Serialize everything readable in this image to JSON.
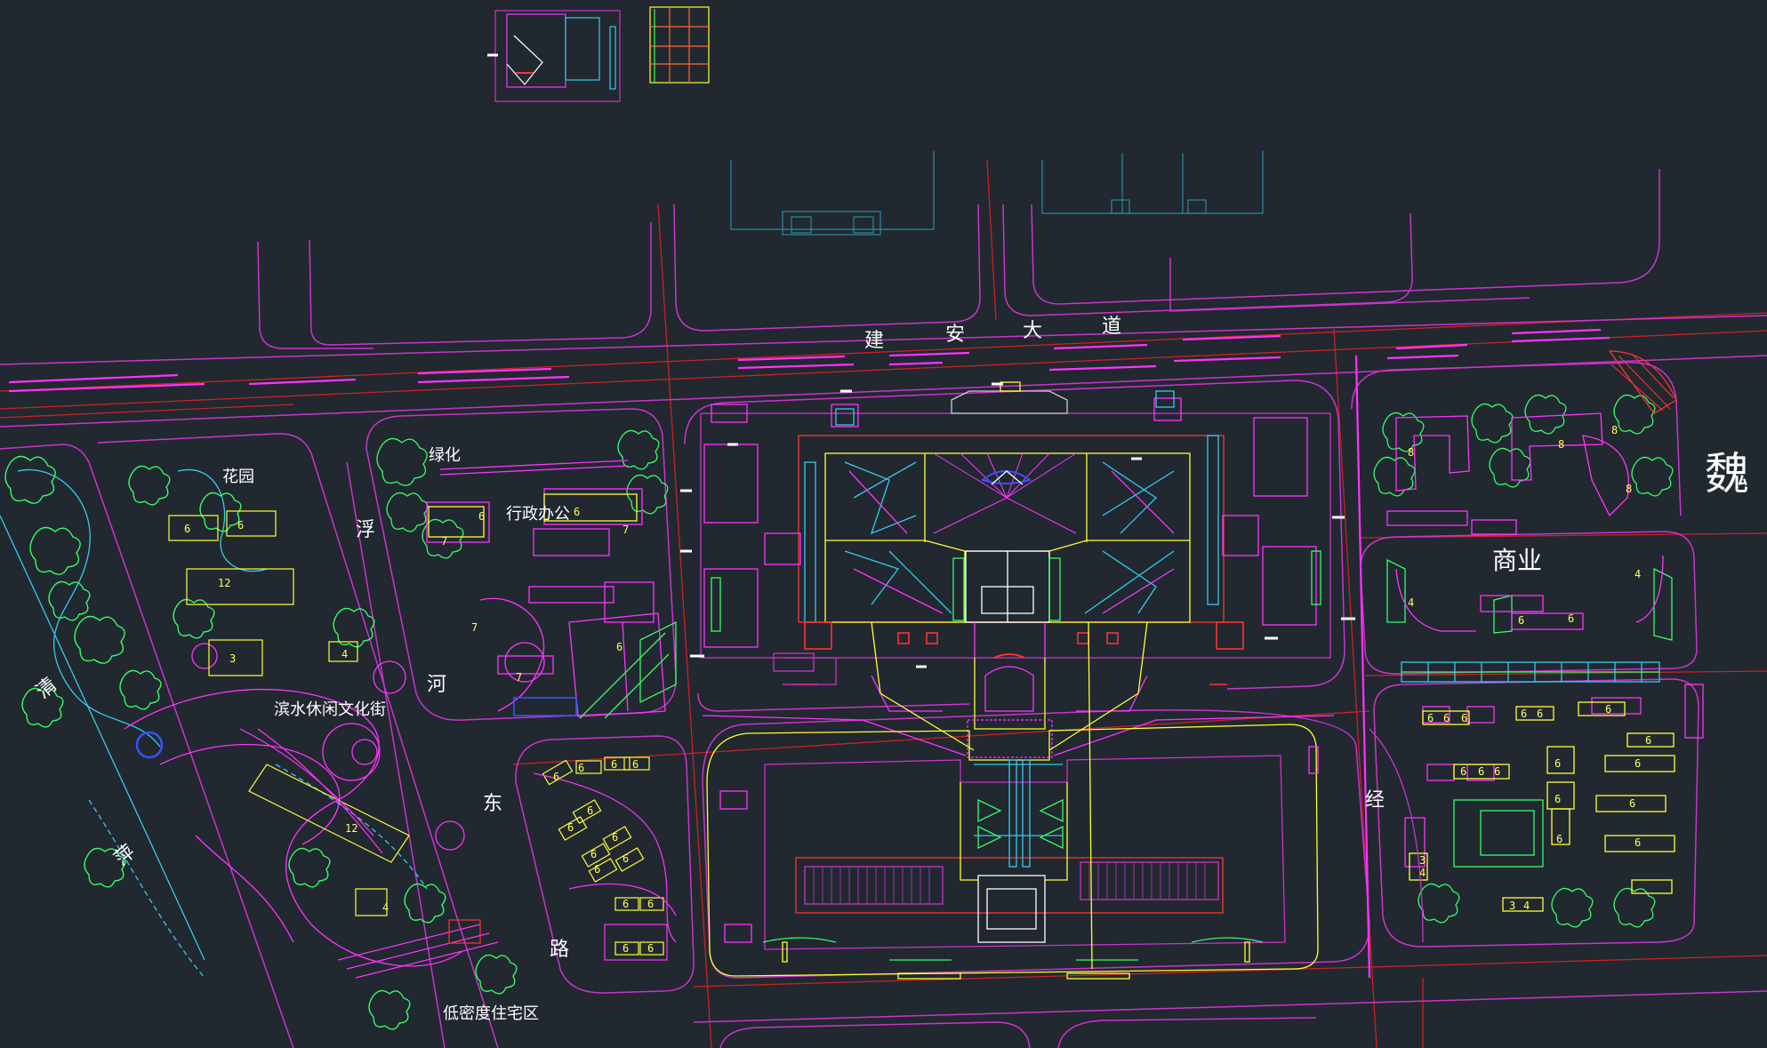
{
  "roads": {
    "jianan_1": "建",
    "jianan_2": "安",
    "jianan_3": "大",
    "jianan_4": "道",
    "fuyi_1": "浮",
    "fuyi_2": "河",
    "fuyi_3": "东",
    "fuyi_4": "路",
    "qing": "清",
    "ping": "萍",
    "jing": "经",
    "wei": "魏"
  },
  "zones": {
    "garden": "花园",
    "greening": "绿化",
    "admin_office": "行政办公",
    "waterfront_street": "滨水休闲文化街",
    "low_density_residential": "低密度住宅区",
    "commercial": "商业"
  },
  "floor_counts": {
    "west_park": [
      "6",
      "6",
      "12",
      "3",
      "4",
      "12",
      "4"
    ],
    "admin_block": [
      "6",
      "6",
      "7",
      "7",
      "7",
      "6",
      "7"
    ],
    "southwest_block": [
      "6",
      "6",
      "6",
      "6",
      "6",
      "6",
      "6",
      "6",
      "6",
      "6",
      "6",
      "6",
      "6",
      "6"
    ],
    "east_north": [
      "8",
      "8",
      "8",
      "8"
    ],
    "east_commercial": [
      "4",
      "4",
      "6",
      "6"
    ],
    "east_south": [
      "6",
      "6",
      "6",
      "6",
      "6",
      "6",
      "6",
      "6",
      "6",
      "6",
      "6",
      "6",
      "6",
      "6",
      "6",
      "6",
      "3",
      "4",
      "3",
      "4"
    ]
  },
  "colors": {
    "background": "#212830",
    "road_edge": "#cc33cc",
    "road_center": "#cc2222",
    "green": "#33ff66",
    "cyan": "#33ccee",
    "yellow": "#ffff33",
    "magenta": "#ff33ff",
    "text": "#ffffff",
    "floor_number": "#ffff55"
  }
}
